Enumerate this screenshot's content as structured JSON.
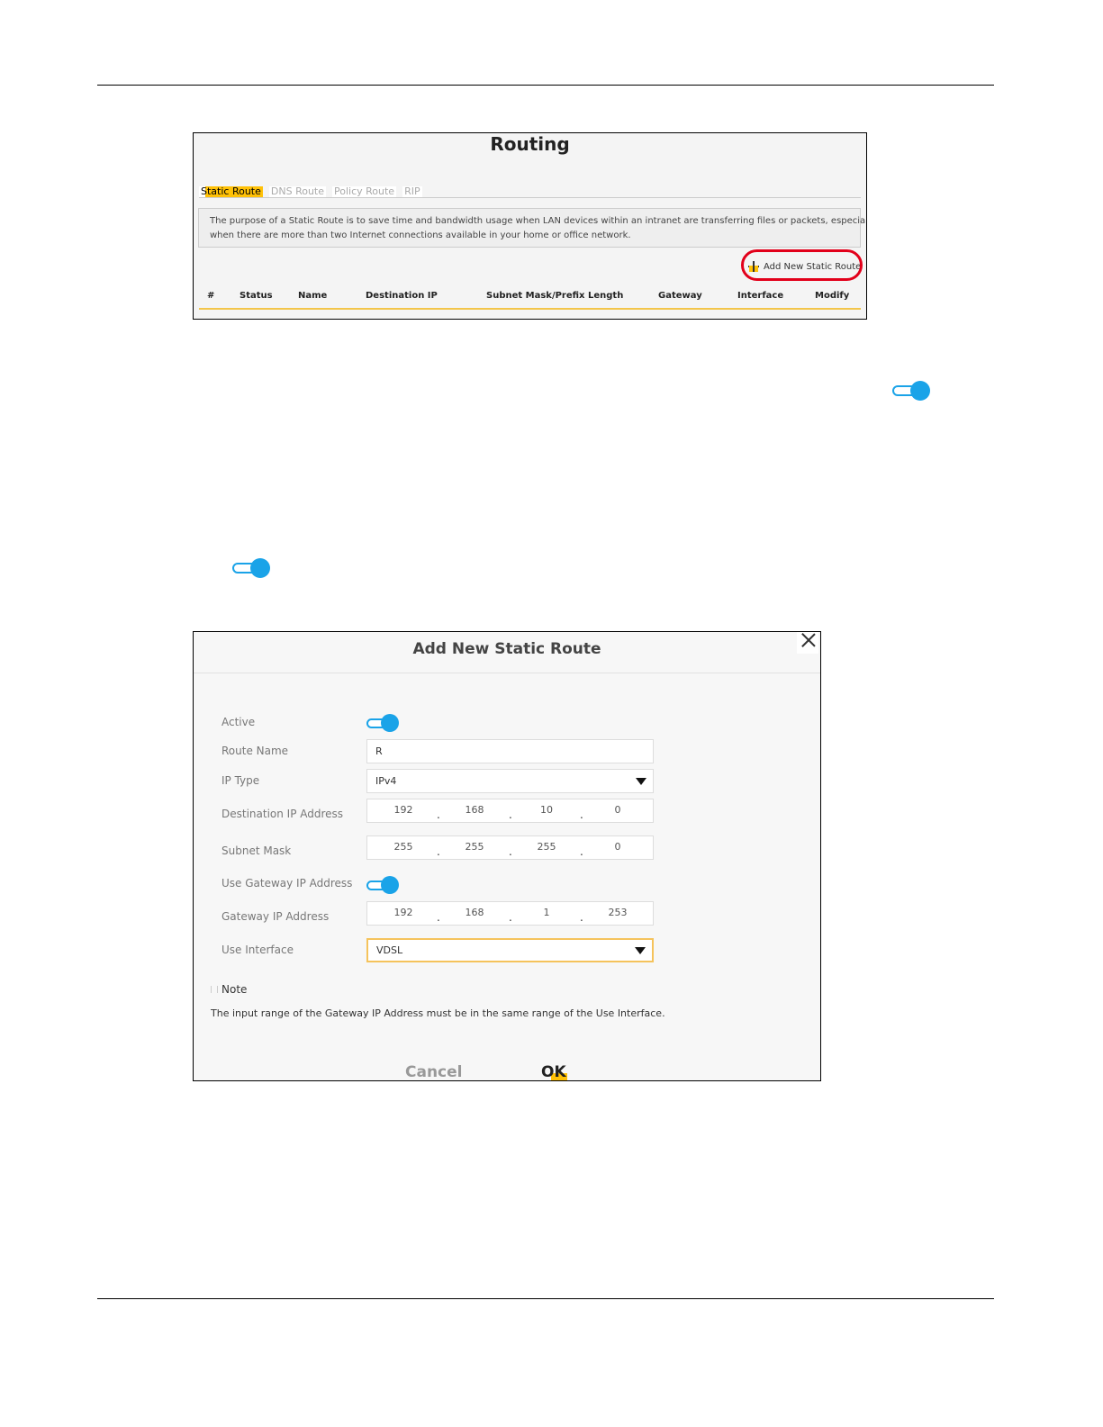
{
  "routing": {
    "title": "Routing",
    "tabs": [
      {
        "label": "Static Route",
        "active": true
      },
      {
        "label": "DNS Route",
        "active": false
      },
      {
        "label": "Policy Route",
        "active": false
      },
      {
        "label": "RIP",
        "active": false
      }
    ],
    "description_line1": "The purpose of a Static Route is to save time and bandwidth usage when LAN devices within an intranet are transferring files or packets, especially",
    "description_line2": "when there are more than two Internet connections available in your home or office network.",
    "add_button_label": "Add New Static Route",
    "columns": [
      "#",
      "Status",
      "Name",
      "Destination IP",
      "Subnet Mask/Prefix Length",
      "Gateway",
      "Interface",
      "Modify"
    ]
  },
  "toggles": {
    "inline_toggle_state": "on",
    "accent_color": "#1aa3e8"
  },
  "dialog": {
    "title": "Add New Static Route",
    "fields": {
      "active": {
        "label": "Active",
        "state": "on"
      },
      "route_name": {
        "label": "Route Name",
        "value": "R"
      },
      "ip_type": {
        "label": "IP Type",
        "value": "IPv4"
      },
      "destination_ip": {
        "label": "Destination IP Address",
        "octets": [
          "192",
          "168",
          "10",
          "0"
        ]
      },
      "subnet_mask": {
        "label": "Subnet Mask",
        "octets": [
          "255",
          "255",
          "255",
          "0"
        ]
      },
      "use_gateway": {
        "label": "Use Gateway IP Address",
        "state": "on"
      },
      "gateway_ip": {
        "label": "Gateway IP Address",
        "octets": [
          "192",
          "168",
          "1",
          "253"
        ]
      },
      "use_interface": {
        "label": "Use Interface",
        "value": "VDSL"
      }
    },
    "note_title": "Note",
    "note_text": "The input range of the Gateway IP Address must be in the same range of the Use Interface.",
    "cancel_label": "Cancel",
    "ok_label": "OK",
    "highlight_color": "#ffc107"
  }
}
